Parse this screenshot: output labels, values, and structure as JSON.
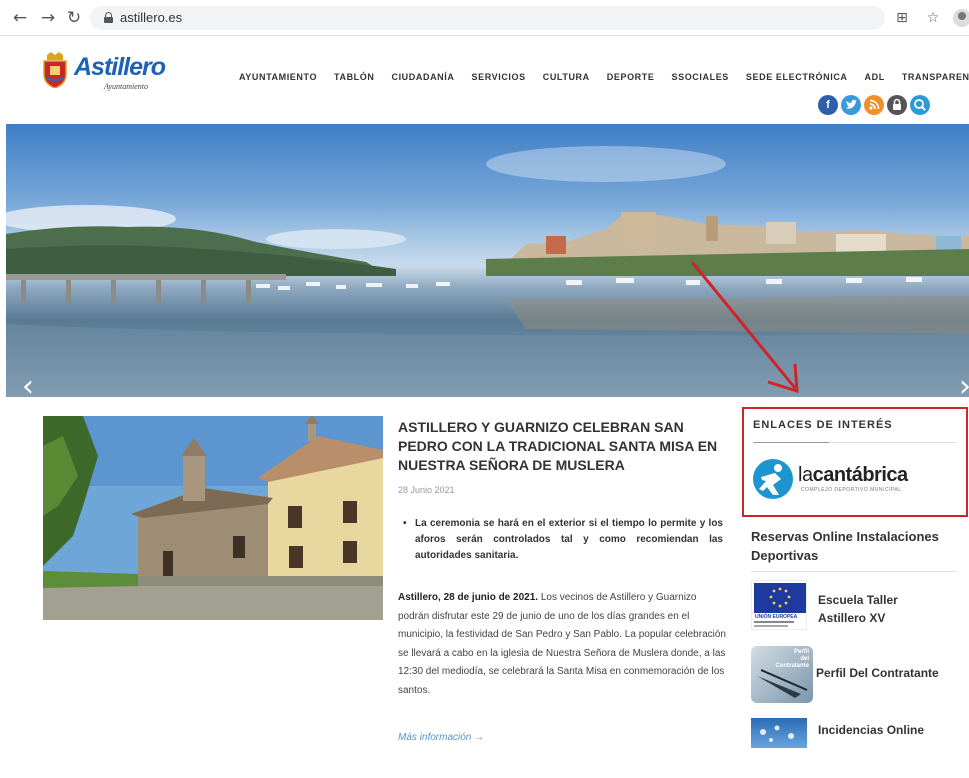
{
  "browser": {
    "back_icon": "arrow-left-icon",
    "forward_icon": "arrow-right-icon",
    "reload_icon": "reload-icon",
    "url": "astillero.es"
  },
  "site": {
    "logo_name": "Astillero",
    "logo_sub": "Ayuntamiento",
    "nav": [
      "AYUNTAMIENTO",
      "TABLÓN",
      "CIUDADANÍA",
      "SERVICIOS",
      "CULTURA",
      "DEPORTE",
      "SSOCIALES",
      "SEDE ELECTRÓNICA",
      "ADL",
      "TRANSPARENCIA"
    ],
    "social_icons": [
      "facebook-icon",
      "twitter-icon",
      "rss-icon",
      "lock-icon",
      "search-icon"
    ],
    "social_colors": [
      "#2f5fa7",
      "#3a9ad9",
      "#f0902a",
      "#555555",
      "#2b9ad6"
    ]
  },
  "article": {
    "title": "ASTILLERO Y GUARNIZO CELEBRAN SAN PEDRO CON LA TRADICIONAL SANTA MISA EN NUESTRA SEÑORA DE MUSLERA",
    "date": "28 Junio 2021",
    "bullet": "La ceremonia se hará en el exterior si el tiempo lo permite y los aforos serán controlados tal y como recomiendan las autoridades sanitaria.",
    "body_lead": "Astillero, 28 de junio de 2021.",
    "body_rest": " Los vecinos de Astillero y Guarnizo podrán disfrutar este 29 de junio de uno de los días grandes en el municipio, la festividad de San Pedro y San Pablo. La popular celebración se llevará a cabo en la iglesia de Nuestra Señora de Muslera donde, a las 12:30 del mediodía, se celebrará la Santa Misa en conmemoración de los santos.",
    "more_link": "Más información →"
  },
  "sidebar": {
    "heading": "ENLACES DE INTERÉS",
    "lacantabrica_la": "la",
    "lacantabrica_name": "cantábrica",
    "lacantabrica_sub": "COMPLEJO DEPORTIVO MUNICIPAL",
    "reservas": "Reservas Online Instalaciones Deportivas",
    "escuela": "Escuela Taller Astillero XV",
    "eu_caption": "UNIÓN EUROPEA",
    "perfil": "Perfil Del Contratante",
    "perfil_badge_1": "Perfil",
    "perfil_badge_2": "del",
    "perfil_badge_3": "Contratante",
    "incidencias": "Incidencias Online"
  },
  "colors": {
    "highlight": "#d0232a",
    "brand_blue": "#1e63b3"
  }
}
